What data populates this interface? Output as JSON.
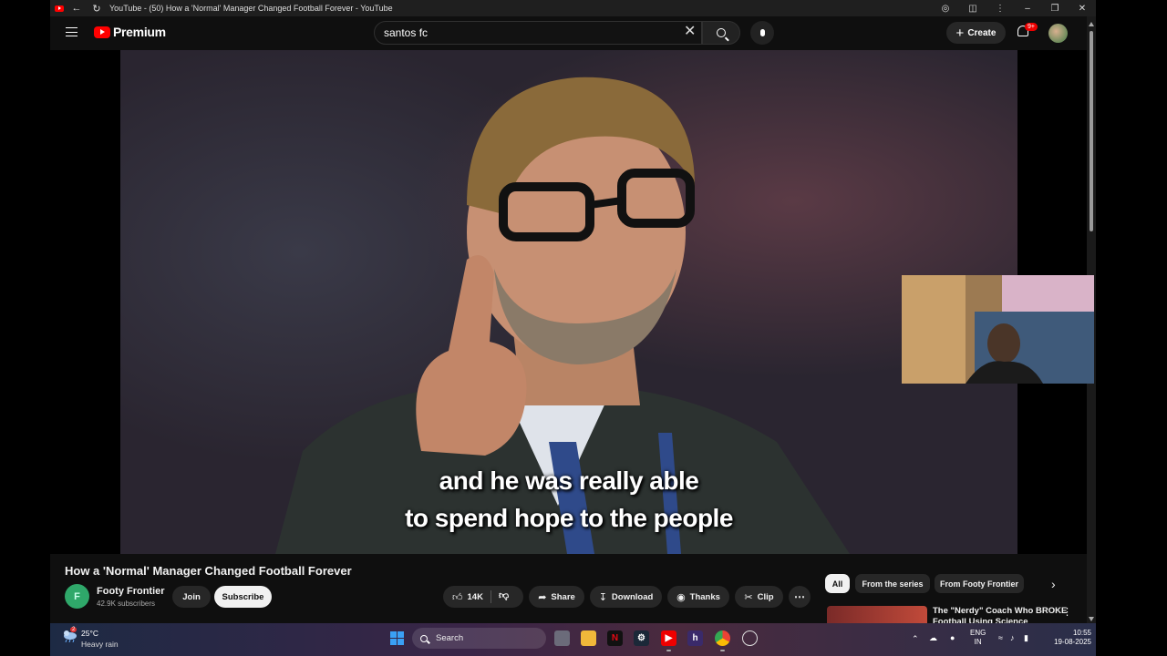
{
  "window": {
    "title": "YouTube - (50) How a 'Normal' Manager Changed Football Forever - YouTube"
  },
  "header": {
    "logo_text": "Premium",
    "search_value": "santos fc",
    "create_label": "Create",
    "notification_badge": "9+"
  },
  "video": {
    "subtitle_line1": "and he was really able",
    "subtitle_line2": "to spend hope to the people"
  },
  "details": {
    "title": "How a 'Normal' Manager Changed Football Forever",
    "channel_name": "Footy Frontier",
    "subscribers": "42.9K subscribers",
    "join_label": "Join",
    "subscribe_label": "Subscribe",
    "like_count": "14K",
    "share_label": "Share",
    "download_label": "Download",
    "thanks_label": "Thanks",
    "clip_label": "Clip"
  },
  "chips": [
    {
      "label": "All"
    },
    {
      "label": "From the series"
    },
    {
      "label": "From Footy Frontier"
    }
  ],
  "recommendation": {
    "title": "The \"Nerdy\" Coach Who BROKE Football Using Science"
  },
  "taskbar": {
    "temperature": "25°C",
    "weather": "Heavy rain",
    "weather_badge": "2",
    "search_label": "Search",
    "lang_line1": "ENG",
    "lang_line2": "IN",
    "time": "10:55",
    "date": "19-08-2025"
  },
  "colors": {
    "youtube_red": "#ff0000",
    "background": "#0f0f0f",
    "chip_active": "#f1f1f1"
  }
}
